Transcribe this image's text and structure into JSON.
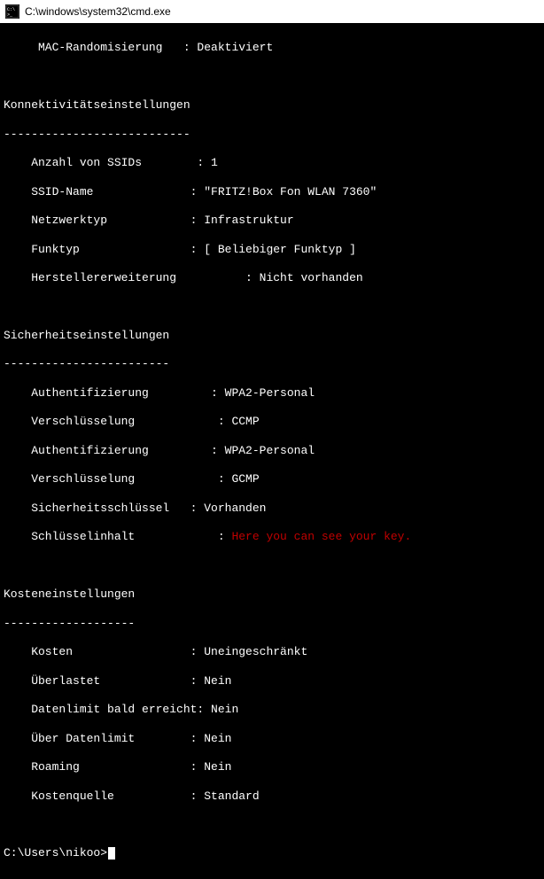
{
  "titlebar": {
    "title": "C:\\windows\\system32\\cmd.exe"
  },
  "lines": {
    "mac_random": "     MAC-Randomisierung   : Deaktiviert",
    "empty": "",
    "conn_header": "Konnektivitätseinstellungen",
    "conn_dashes": "---------------------------",
    "ssid_count": "    Anzahl von SSIDs        : 1",
    "ssid_name": "    SSID-Name              : \"FRITZ!Box Fon WLAN 7360\"",
    "nettype": "    Netzwerktyp            : Infrastruktur",
    "radiotype": "    Funktyp                : [ Beliebiger Funktyp ]",
    "vendor_ext": "    Herstellererweiterung          : Nicht vorhanden",
    "sec_header": "Sicherheitseinstellungen",
    "sec_dashes": "------------------------",
    "auth1": "    Authentifizierung         : WPA2-Personal",
    "enc1": "    Verschlüsselung            : CCMP",
    "auth2": "    Authentifizierung         : WPA2-Personal",
    "enc2": "    Verschlüsselung            : GCMP",
    "seckey": "    Sicherheitsschlüssel   : Vorhanden",
    "key_label": "    Schlüsselinhalt            : ",
    "key_value": "Here you can see your key.",
    "cost_header": "Kosteneinstellungen",
    "cost_dashes": "-------------------",
    "cost": "    Kosten                 : Uneingeschränkt",
    "overload": "    Überlastet             : Nein",
    "datalimit_near": "    Datenlimit bald erreicht: Nein",
    "over_datalimit": "    Über Datenlimit        : Nein",
    "roaming": "    Roaming                : Nein",
    "costsource": "    Kostenquelle           : Standard",
    "prompt": "C:\\Users\\nikoo>"
  }
}
